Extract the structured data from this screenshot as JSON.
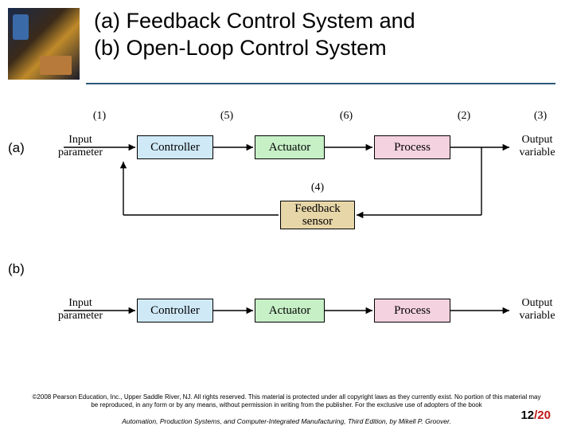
{
  "title_line1": "(a) Feedback Control System and",
  "title_line2": "(b) Open-Loop Control System",
  "diagram_a": {
    "label": "(a)",
    "markers": {
      "m1": "(1)",
      "m5": "(5)",
      "m6": "(6)",
      "m2": "(2)",
      "m3": "(3)",
      "m4": "(4)"
    },
    "input_label": "Input\nparameter",
    "output_label": "Output\nvariable",
    "boxes": {
      "controller": "Controller",
      "actuator": "Actuator",
      "process": "Process",
      "feedback": "Feedback\nsensor"
    }
  },
  "diagram_b": {
    "label": "(b)",
    "input_label": "Input\nparameter",
    "output_label": "Output\nvariable",
    "boxes": {
      "controller": "Controller",
      "actuator": "Actuator",
      "process": "Process"
    }
  },
  "footer": {
    "copyright": "©2008 Pearson Education, Inc., Upper Saddle River, NJ. All rights reserved. This material is protected under all copyright laws as they currently exist. No portion of this material may be reproduced, in any form or by any means, without permission in writing from the publisher. For the exclusive use of adopters of the book",
    "book": "Automation, Production Systems, and Computer-Integrated Manufacturing, Third Edition, by Mikell P. Groover.",
    "page_current": "12",
    "page_total": "/20"
  }
}
